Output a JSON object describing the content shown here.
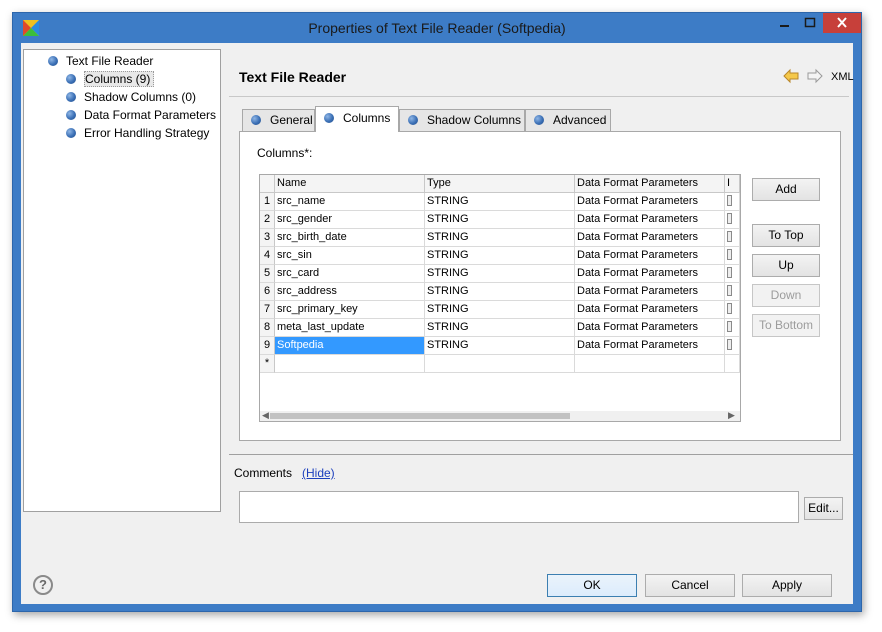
{
  "window": {
    "title": "Properties of Text File Reader (Softpedia)"
  },
  "tree": {
    "root": "Text File Reader",
    "items": [
      {
        "label": "Columns (9)",
        "selected": true
      },
      {
        "label": "Shadow Columns (0)"
      },
      {
        "label": "Data Format Parameters"
      },
      {
        "label": "Error Handling Strategy"
      }
    ]
  },
  "header": {
    "title": "Text File Reader",
    "xml": "XML"
  },
  "tabs": [
    "General",
    "Columns",
    "Shadow Columns",
    "Advanced"
  ],
  "active_tab": "Columns",
  "columns_label": "Columns*:",
  "grid": {
    "headers": [
      "Name",
      "Type",
      "Data Format Parameters",
      "I"
    ],
    "rows": [
      {
        "num": "1",
        "name": "src_name",
        "type": "STRING",
        "dfp": "Data Format Parameters"
      },
      {
        "num": "2",
        "name": "src_gender",
        "type": "STRING",
        "dfp": "Data Format Parameters"
      },
      {
        "num": "3",
        "name": "src_birth_date",
        "type": "STRING",
        "dfp": "Data Format Parameters"
      },
      {
        "num": "4",
        "name": "src_sin",
        "type": "STRING",
        "dfp": "Data Format Parameters"
      },
      {
        "num": "5",
        "name": "src_card",
        "type": "STRING",
        "dfp": "Data Format Parameters"
      },
      {
        "num": "6",
        "name": "src_address",
        "type": "STRING",
        "dfp": "Data Format Parameters"
      },
      {
        "num": "7",
        "name": "src_primary_key",
        "type": "STRING",
        "dfp": "Data Format Parameters"
      },
      {
        "num": "8",
        "name": "meta_last_update",
        "type": "STRING",
        "dfp": "Data Format Parameters"
      },
      {
        "num": "9",
        "name": "Softpedia",
        "type": "STRING",
        "dfp": "Data Format Parameters"
      }
    ],
    "new_row_marker": "*",
    "selected_row": 9
  },
  "side_buttons": {
    "add": "Add",
    "to_top": "To Top",
    "up": "Up",
    "down": "Down",
    "to_bottom": "To Bottom"
  },
  "comments": {
    "label": "Comments",
    "hide": "(Hide)",
    "edit": "Edit..."
  },
  "footer": {
    "ok": "OK",
    "cancel": "Cancel",
    "apply": "Apply",
    "help": "?"
  },
  "colors": {
    "titlebar": "#3d7cc6",
    "selection": "#3399ff",
    "close": "#c7403a"
  }
}
